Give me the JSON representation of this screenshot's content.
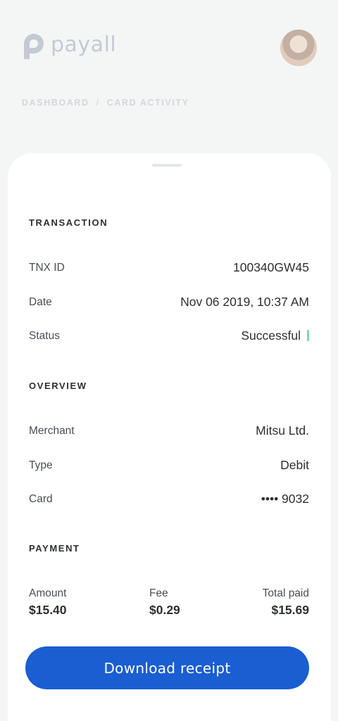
{
  "app": {
    "logo_text": "payall",
    "logo_color": "#7d8aa0"
  },
  "breadcrumb": {
    "items": [
      "DASHBOARD",
      "CARD ACTIVITY"
    ],
    "separator": "/"
  },
  "sections": {
    "transaction": {
      "title": "TRANSACTION",
      "rows": [
        {
          "label": "TNX ID",
          "value": "100340GW45"
        },
        {
          "label": "Date",
          "value": "Nov 06 2019, 10:37 AM"
        },
        {
          "label": "Status",
          "value": "Successful",
          "status_color": "#7fd8a8"
        }
      ]
    },
    "overview": {
      "title": "OVERVIEW",
      "rows": [
        {
          "label": "Merchant",
          "value": "Mitsu Ltd."
        },
        {
          "label": "Type",
          "value": "Debit"
        },
        {
          "label": "Card",
          "value": "•••• 9032"
        }
      ]
    },
    "payment": {
      "title": "PAYMENT",
      "amount_label": "Amount",
      "amount_value": "$15.40",
      "fee_label": "Fee",
      "fee_value": "$0.29",
      "total_label": "Total paid",
      "total_value": "$15.69"
    }
  },
  "actions": {
    "download_label": "Download receipt",
    "button_color": "#1a5ed1"
  },
  "icons": {
    "logo": "payall-logo-icon",
    "avatar": "user-avatar"
  }
}
